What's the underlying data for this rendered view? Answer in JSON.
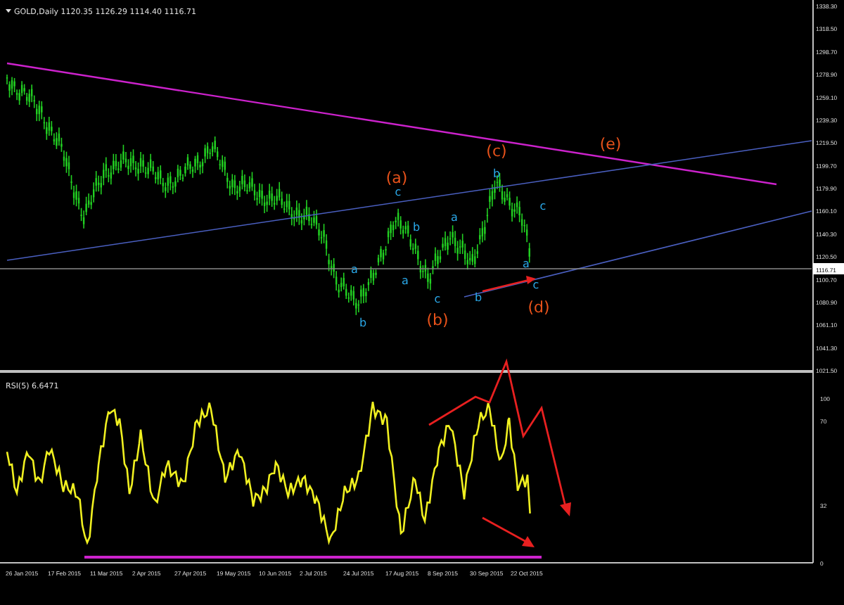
{
  "header": {
    "symbol": "GOLD,Daily",
    "quotes": [
      "1120.35",
      "1126.29",
      "1114.40",
      "1116.71"
    ]
  },
  "price_axis": {
    "labels": [
      "1338.30",
      "1318.50",
      "1298.70",
      "1278.90",
      "1259.10",
      "1239.30",
      "1219.50",
      "1199.70",
      "1179.90",
      "1160.10",
      "1140.30",
      "1120.50",
      "1100.70",
      "1080.90",
      "1061.10",
      "1041.30",
      "1021.50"
    ],
    "current": "1116.71"
  },
  "waves": [
    {
      "label": "(a)",
      "kind": "primary"
    },
    {
      "label": "(b)",
      "kind": "primary"
    },
    {
      "label": "(c)",
      "kind": "primary"
    },
    {
      "label": "(d)",
      "kind": "primary"
    },
    {
      "label": "(e)",
      "kind": "primary"
    },
    {
      "label": "a",
      "kind": "minor"
    },
    {
      "label": "b",
      "kind": "minor"
    },
    {
      "label": "a",
      "kind": "minor"
    },
    {
      "label": "b",
      "kind": "minor"
    },
    {
      "label": "c",
      "kind": "minor"
    },
    {
      "label": "c",
      "kind": "minor"
    },
    {
      "label": "a",
      "kind": "minor"
    },
    {
      "label": "b",
      "kind": "minor"
    },
    {
      "label": "c",
      "kind": "minor"
    },
    {
      "label": "b",
      "kind": "minor"
    },
    {
      "label": "a",
      "kind": "minor"
    },
    {
      "label": "c",
      "kind": "minor"
    }
  ],
  "rsi": {
    "label": "RSI(5) 6.6471",
    "ticks": [
      "100",
      "70",
      "32",
      "0"
    ]
  },
  "dates": [
    "26 Jan 2015",
    "17 Feb 2015",
    "11 Mar 2015",
    "2 Apr 2015",
    "27 Apr 2015",
    "19 May 2015",
    "10 Jun 2015",
    "2 Jul 2015",
    "24 Jul 2015",
    "17 Aug 2015",
    "8 Sep 2015",
    "30 Sep 2015",
    "22 Oct 2015"
  ]
}
